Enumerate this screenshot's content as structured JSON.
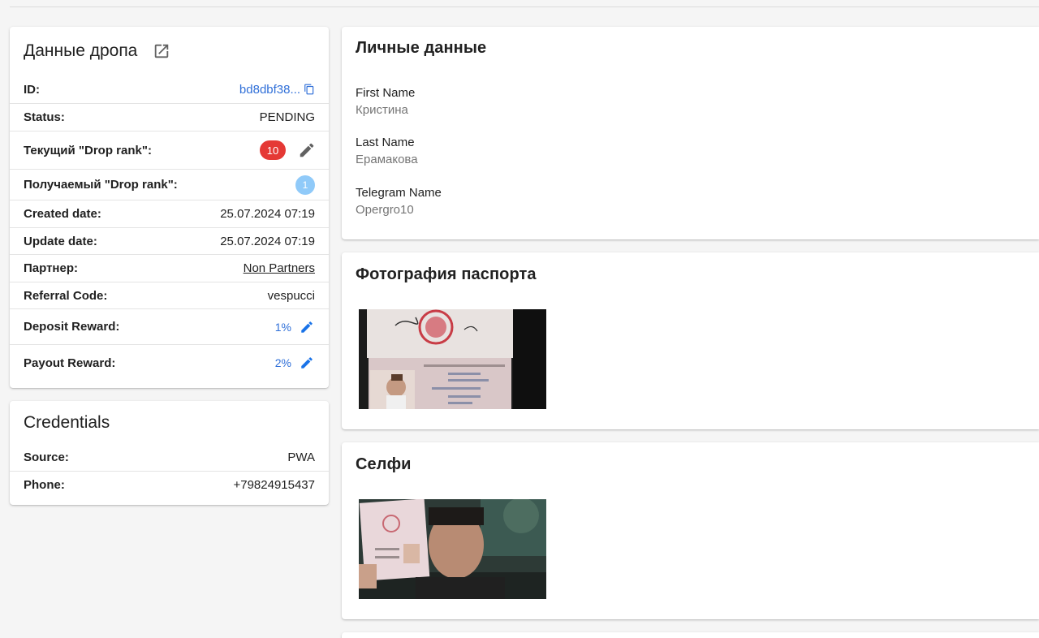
{
  "drop_card": {
    "title": "Данные дропа",
    "open_icon": "open-in-new-icon",
    "rows": {
      "id": {
        "label": "ID:",
        "value": "bd8dbf38...",
        "icon": "copy-icon"
      },
      "status": {
        "label": "Status:",
        "value": "PENDING"
      },
      "current_rank": {
        "label": "Текущий \"Drop rank\":",
        "value": "10",
        "icon": "pencil-icon",
        "color": "#e53935"
      },
      "received_rank": {
        "label": "Получаемый \"Drop rank\":",
        "value": "1",
        "color": "#90caf9"
      },
      "created": {
        "label": "Created date:",
        "value": "25.07.2024 07:19"
      },
      "updated": {
        "label": "Update date:",
        "value": "25.07.2024 07:19"
      },
      "partner": {
        "label": "Партнер:",
        "value": "Non Partners"
      },
      "referral": {
        "label": "Referral Code:",
        "value": "vespucci"
      },
      "deposit": {
        "label": "Deposit Reward:",
        "value": "1%",
        "icon": "pencil-icon"
      },
      "payout": {
        "label": "Payout Reward:",
        "value": "2%",
        "icon": "pencil-icon"
      }
    }
  },
  "credentials": {
    "title": "Credentials",
    "rows": {
      "source": {
        "label": "Source:",
        "value": "PWA"
      },
      "phone": {
        "label": "Phone:",
        "value": "+79824915437"
      }
    }
  },
  "personal": {
    "title": "Личные данные",
    "fields": [
      {
        "label": "First Name",
        "value": "Кристина"
      },
      {
        "label": "Last Name",
        "value": "Ерамакова"
      },
      {
        "label": "Telegram Name",
        "value": "Opergro10"
      }
    ]
  },
  "passport": {
    "title": "Фотография паспорта"
  },
  "selfie": {
    "title": "Селфи"
  },
  "colors": {
    "link": "#2f6fd8",
    "accent_edit": "#1a73e8"
  }
}
